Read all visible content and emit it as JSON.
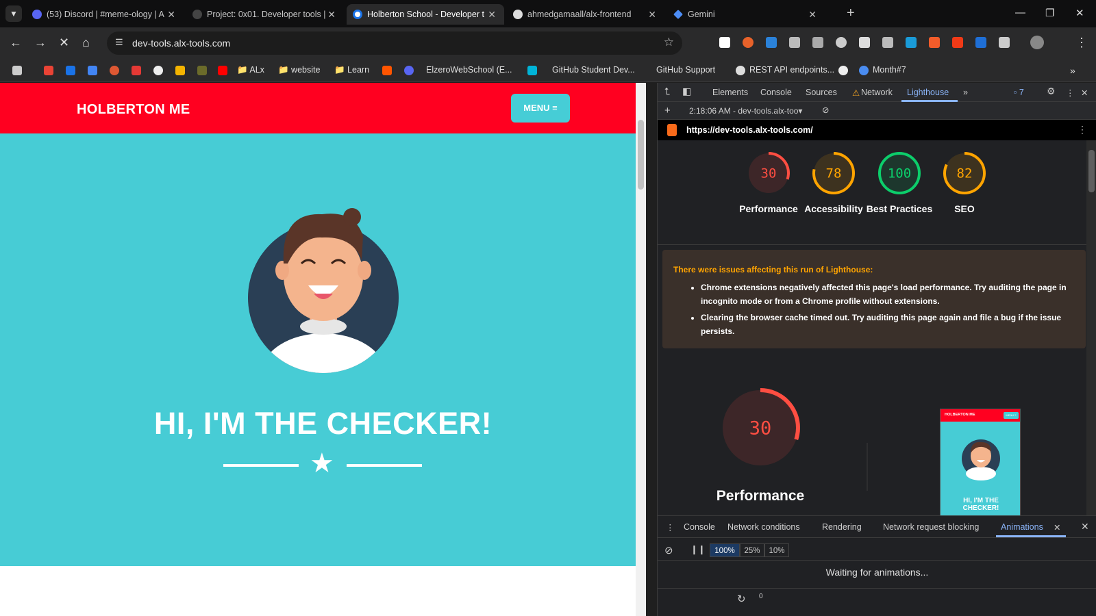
{
  "tabs": [
    {
      "title": "(53) Discord | #meme-ology | A",
      "active": false
    },
    {
      "title": "Project: 0x01. Developer tools |",
      "active": false
    },
    {
      "title": "Holberton School - Developer t",
      "active": true
    },
    {
      "title": "ahmedgamaall/alx-frontend",
      "active": false
    },
    {
      "title": "Gemini",
      "active": false
    }
  ],
  "address_bar": {
    "url": "dev-tools.alx-tools.com"
  },
  "bookmarks": [
    "ALx",
    "website",
    "Learn",
    "ElzeroWebSchool (E...",
    "GitHub Student Dev...",
    "GitHub Support",
    "REST API endpoints...",
    "Month#7"
  ],
  "page": {
    "logo": "HOLBERTON ME",
    "menu_label": "MENU ≡",
    "hero_title": "HI, I'M THE CHECKER!"
  },
  "devtools": {
    "tabs": [
      "Elements",
      "Console",
      "Sources",
      "Network",
      "Lighthouse"
    ],
    "active_tab": "Lighthouse",
    "issue_count": "7",
    "report_time": "2:18:06 AM - dev-tools.alx-too▾",
    "report_url": "https://dev-tools.alx-tools.com/",
    "scores": [
      {
        "label": "Performance",
        "value": 30,
        "color": "#ff4e42"
      },
      {
        "label": "Accessibility",
        "value": 78,
        "color": "#ffa400"
      },
      {
        "label": "Best Practices",
        "value": 100,
        "color": "#0cce6b"
      },
      {
        "label": "SEO",
        "value": 82,
        "color": "#ffa400"
      }
    ],
    "notice": {
      "heading": "There were issues affecting this run of Lighthouse:",
      "items": [
        "Chrome extensions negatively affected this page's load performance. Try auditing the page in incognito mode or from a Chrome profile without extensions.",
        "Clearing the browser cache timed out. Try auditing this page again and file a bug if the issue persists."
      ]
    },
    "big_score": {
      "value": 30,
      "label": "Performance"
    },
    "thumbnail": {
      "logo": "HOLBERTON ME",
      "menu": "MENU ≡",
      "title": "HI, I'M THE CHECKER!"
    },
    "drawer": {
      "tabs": [
        "Console",
        "Network conditions",
        "Rendering",
        "Network request blocking",
        "Animations"
      ],
      "active_tab": "Animations",
      "speeds": [
        "100%",
        "25%",
        "10%"
      ],
      "selected_speed": "100%",
      "waiting_text": "Waiting for animations...",
      "timeline_zero": "0"
    }
  },
  "colors": {
    "header_red": "#ff0020",
    "hero_teal": "#47ccd5",
    "devtools_bg": "#202124",
    "accent_blue": "#8ab4f8"
  }
}
